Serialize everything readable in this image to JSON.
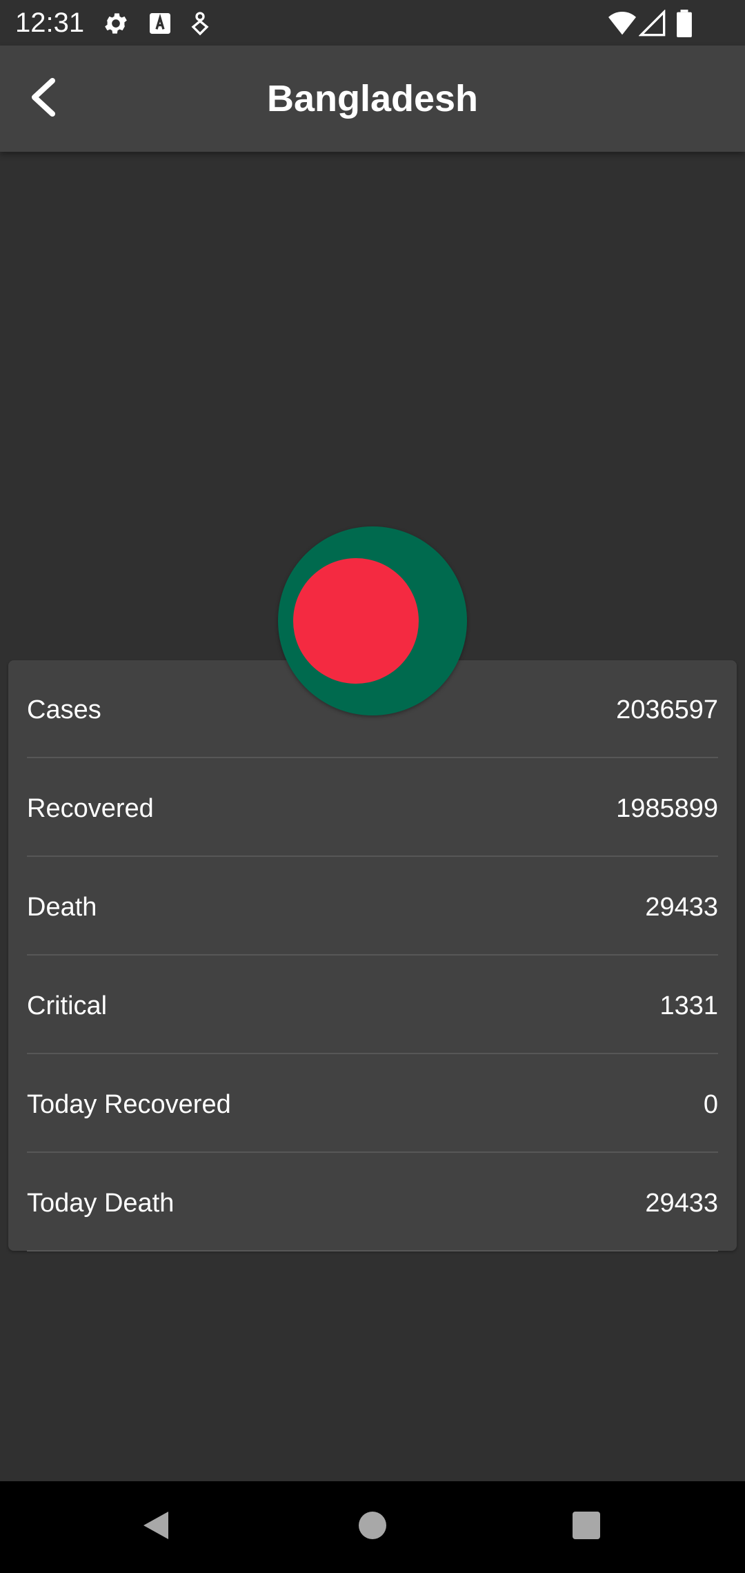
{
  "status_bar": {
    "time": "12:31",
    "left_icons": [
      "gear-icon",
      "font-download-icon",
      "location-heart-icon"
    ],
    "right_icons": [
      "wifi-icon",
      "signal-icon",
      "battery-icon"
    ]
  },
  "app_bar": {
    "title": "Bangladesh",
    "back_icon": "back-chevron-icon"
  },
  "flag": {
    "country": "Bangladesh",
    "field_color": "#006a4e",
    "disc_color": "#f42a41"
  },
  "stats": [
    {
      "label": "Cases",
      "value": "2036597"
    },
    {
      "label": "Recovered",
      "value": "1985899"
    },
    {
      "label": "Death",
      "value": "29433"
    },
    {
      "label": "Critical",
      "value": "1331"
    },
    {
      "label": "Today Recovered",
      "value": "0"
    },
    {
      "label": "Today Death",
      "value": "29433"
    }
  ],
  "nav_bar": {
    "buttons": [
      "back-triangle-icon",
      "home-circle-icon",
      "recents-square-icon"
    ]
  }
}
